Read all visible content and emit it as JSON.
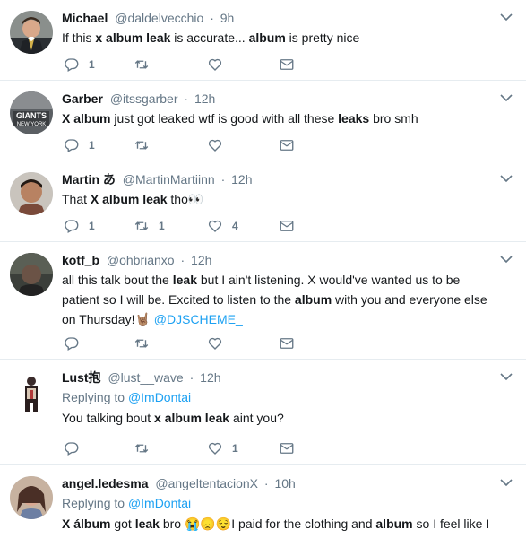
{
  "tweets": [
    {
      "name": "Michael",
      "handle": "@daldelvecchio",
      "time": "9h",
      "segments": [
        {
          "t": "If this "
        },
        {
          "t": "x album leak",
          "b": true
        },
        {
          "t": " is accurate... "
        },
        {
          "t": "album",
          "b": true
        },
        {
          "t": " is pretty nice"
        }
      ],
      "reply_count": "1",
      "retweet_count": "",
      "like_count": ""
    },
    {
      "name": "Garber",
      "handle": "@itssgarber",
      "time": "12h",
      "avatar_text": "GIANTS NEW YORK",
      "segments": [
        {
          "t": "X album",
          "b": true
        },
        {
          "t": " just got leaked wtf is good with all these "
        },
        {
          "t": "leaks",
          "b": true
        },
        {
          "t": " bro smh"
        }
      ],
      "reply_count": "1",
      "retweet_count": "",
      "like_count": ""
    },
    {
      "name": "Martin あ",
      "handle": "@MartinMartiinn",
      "time": "12h",
      "segments": [
        {
          "t": "That "
        },
        {
          "t": "X album leak",
          "b": true
        },
        {
          "t": " tho👀"
        }
      ],
      "reply_count": "1",
      "retweet_count": "1",
      "like_count": "4"
    },
    {
      "name": "kotf_b",
      "handle": "@ohbrianxo",
      "time": "12h",
      "segments": [
        {
          "t": "all this talk bout the "
        },
        {
          "t": "leak",
          "b": true
        },
        {
          "t": " but I ain't listening. X would've wanted us to be patient so I will be. Excited to listen to the "
        },
        {
          "t": "album",
          "b": true
        },
        {
          "t": " with you and everyone else  on Thursday!🤘🏽 "
        },
        {
          "t": "@DJSCHEME_",
          "m": true
        }
      ],
      "reply_count": "",
      "retweet_count": "",
      "like_count": ""
    },
    {
      "name": "Lust抱",
      "handle": "@lust__wave",
      "time": "12h",
      "replying_label": "Replying to",
      "replying_to": "@ImDontai",
      "segments": [
        {
          "t": "You talking bout "
        },
        {
          "t": "x album leak",
          "b": true
        },
        {
          "t": " aint you?"
        }
      ],
      "reply_count": "",
      "retweet_count": "",
      "like_count": "1"
    },
    {
      "name": "angel.ledesma",
      "handle": "@angeltentacionX",
      "time": "10h",
      "replying_label": "Replying to",
      "replying_to": "@ImDontai",
      "segments": [
        {
          "t": "X álbum",
          "b": true
        },
        {
          "t": " got "
        },
        {
          "t": "leak",
          "b": true
        },
        {
          "t": " bro 😭😞😌I paid for the clothing and "
        },
        {
          "t": "album",
          "b": true
        },
        {
          "t": " so I feel like I"
        }
      ],
      "reply_count": "",
      "retweet_count": "",
      "like_count": ""
    }
  ],
  "colors": {
    "text": "#14171a",
    "secondary": "#657786",
    "link": "#1da1f2",
    "divider": "#e6ecf0"
  }
}
